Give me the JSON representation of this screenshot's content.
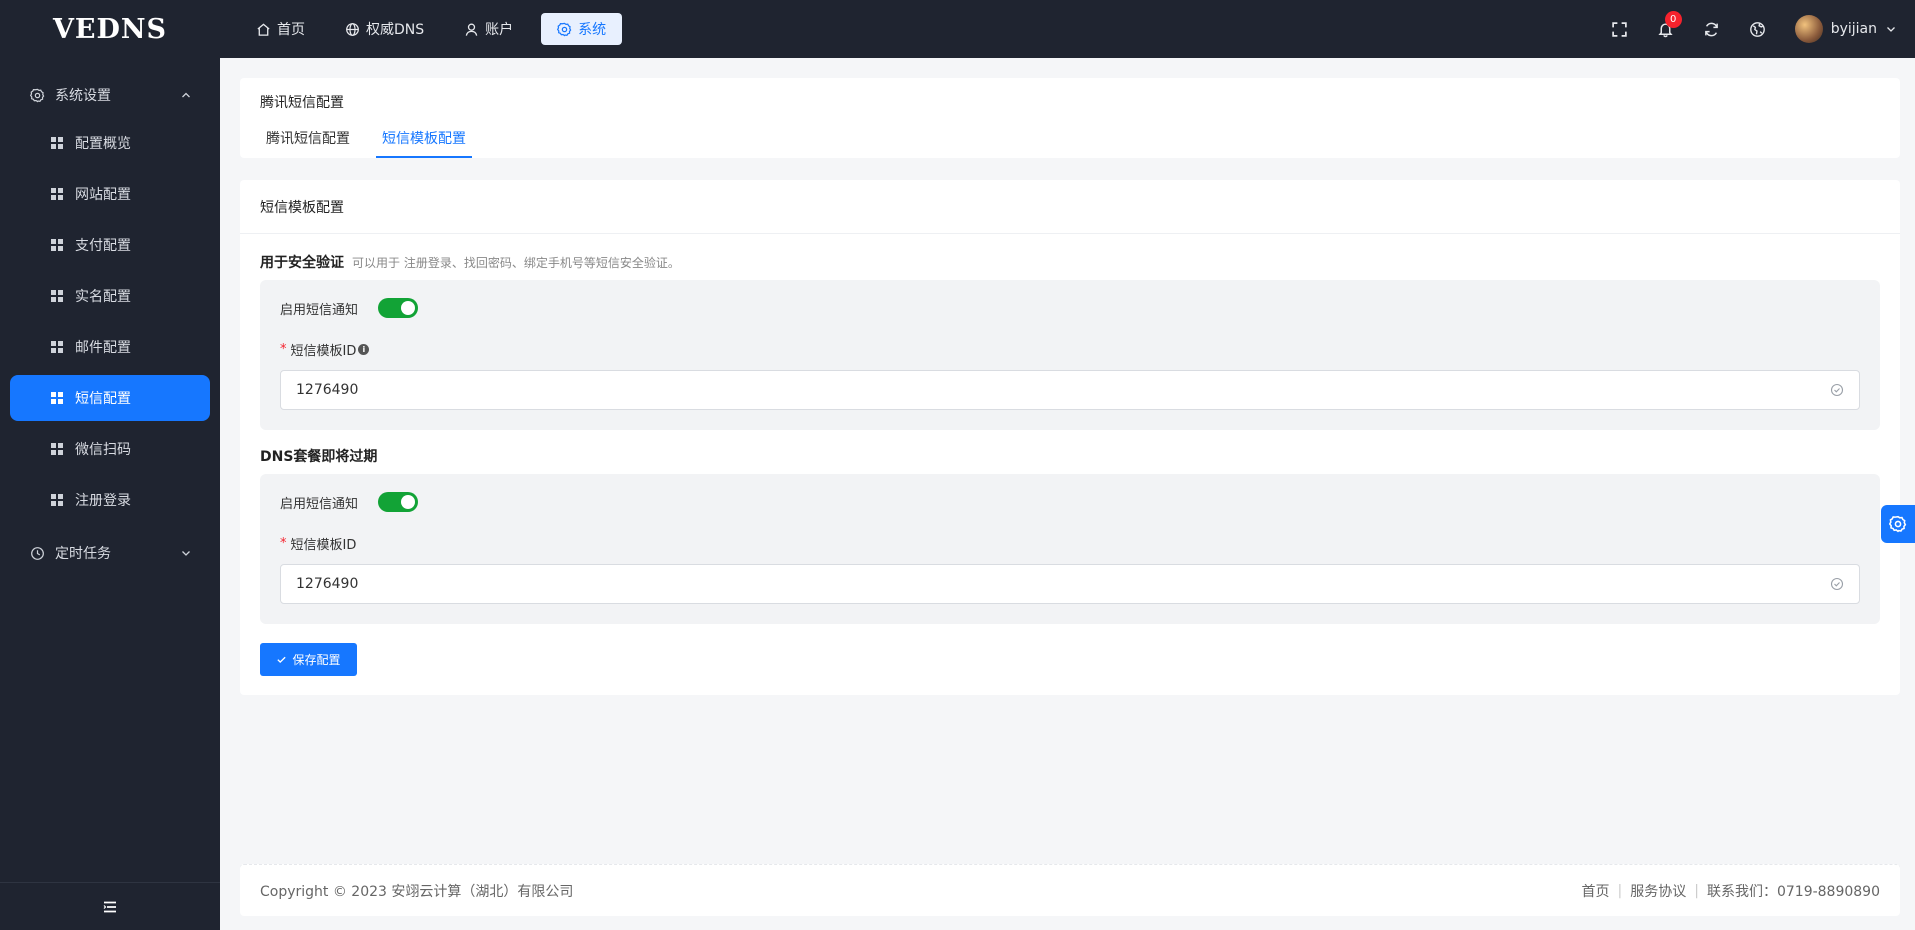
{
  "app": {
    "logo": "VEDNS"
  },
  "topnav": [
    {
      "label": "首页",
      "icon": "home-icon",
      "active": false
    },
    {
      "label": "权威DNS",
      "icon": "globe-icon",
      "active": false
    },
    {
      "label": "账户",
      "icon": "user-icon",
      "active": false
    },
    {
      "label": "系统",
      "icon": "gear-icon",
      "active": true
    }
  ],
  "header": {
    "notification_count": "0",
    "username": "byijian"
  },
  "sidebar": {
    "group_system": "系统设置",
    "items": [
      "配置概览",
      "网站配置",
      "支付配置",
      "实名配置",
      "邮件配置",
      "短信配置",
      "微信扫码",
      "注册登录"
    ],
    "active_item": "短信配置",
    "group_cron": "定时任务"
  },
  "page": {
    "title": "腾讯短信配置",
    "tabs": [
      "腾讯短信配置",
      "短信模板配置"
    ],
    "active_tab": "短信模板配置"
  },
  "form": {
    "title": "短信模板配置",
    "sections": [
      {
        "title": "用于安全验证",
        "hint": "可以用于 注册登录、找回密码、绑定手机号等短信安全验证。",
        "switch_label": "启用短信通知",
        "enabled": true,
        "field_label": "短信模板ID",
        "field_value": "1276490"
      },
      {
        "title": "DNS套餐即将过期",
        "switch_label": "启用短信通知",
        "enabled": true,
        "field_label": "短信模板ID",
        "field_value": "1276490"
      }
    ],
    "save_label": "保存配置"
  },
  "footer": {
    "copyright": "Copyright © 2023 安翊云计算（湖北）有限公司",
    "link_home": "首页",
    "link_terms": "服务协议",
    "contact": "联系我们：0719-8890890"
  },
  "colors": {
    "primary": "#1677ff",
    "topbar": "#1f2430",
    "switch_on": "#12a336"
  }
}
